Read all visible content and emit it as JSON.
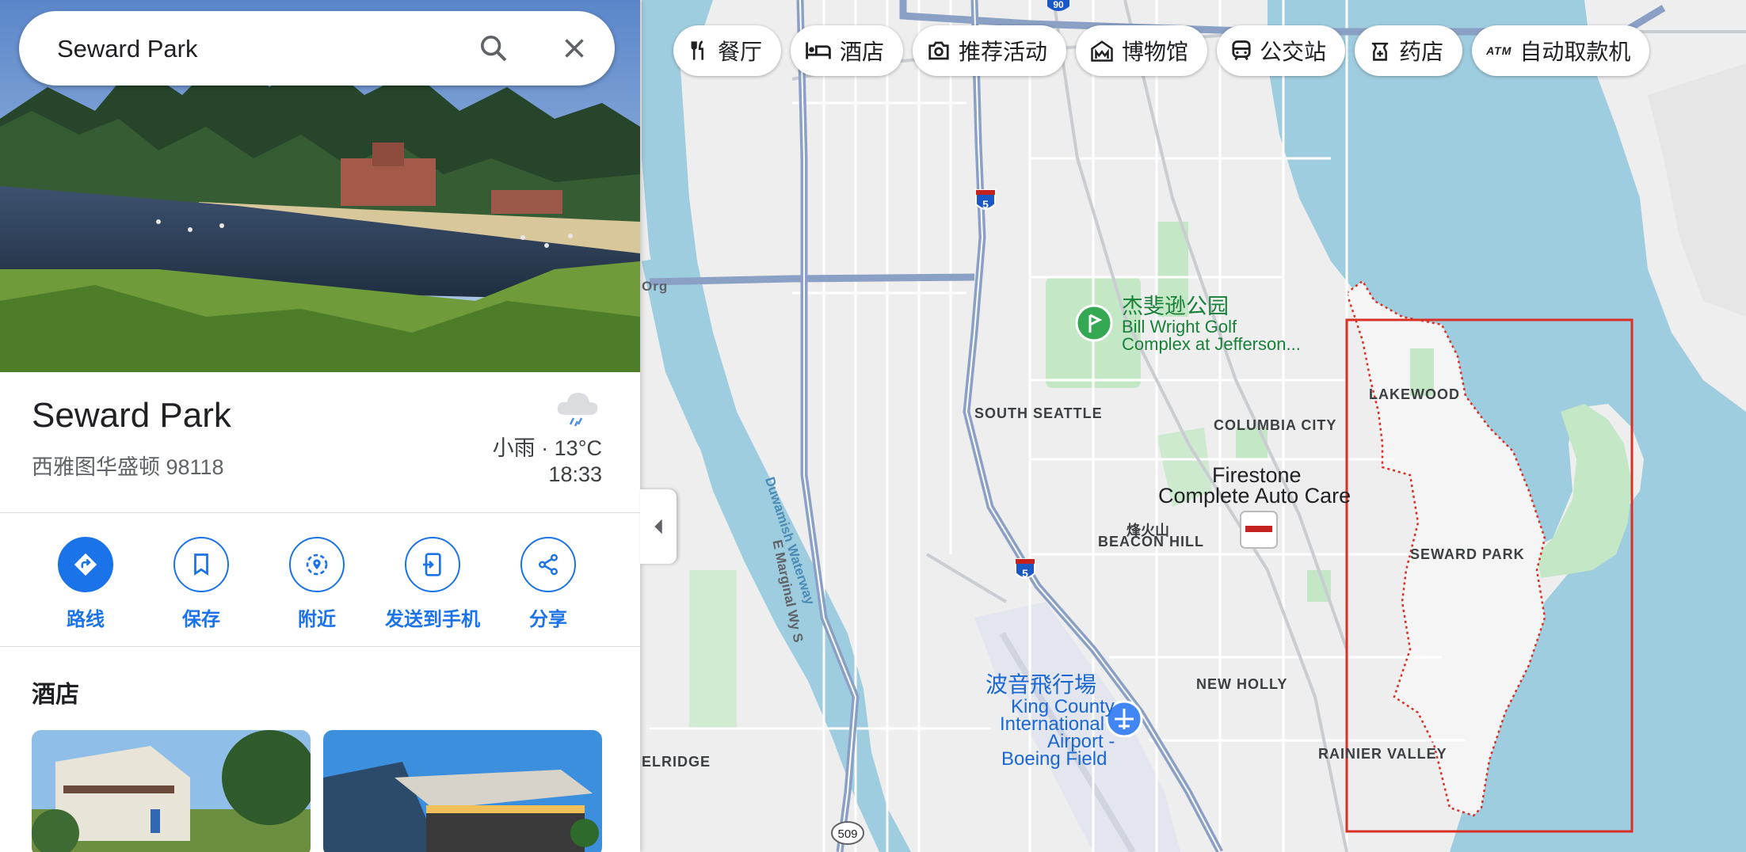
{
  "search": {
    "value": "Seward Park"
  },
  "place": {
    "title": "Seward Park",
    "address": "西雅图华盛顿 98118",
    "weather_condition": "小雨 · 13°C",
    "time": "18:33"
  },
  "actions": [
    {
      "label": "路线",
      "icon": "directions-icon"
    },
    {
      "label": "保存",
      "icon": "bookmark-icon"
    },
    {
      "label": "附近",
      "icon": "nearby-icon"
    },
    {
      "label": "发送到手机",
      "icon": "send-to-phone-icon"
    },
    {
      "label": "分享",
      "icon": "share-icon"
    }
  ],
  "hotels": {
    "section_title": "酒店"
  },
  "chips": [
    {
      "label": "餐厅",
      "icon": "restaurant-icon"
    },
    {
      "label": "酒店",
      "icon": "hotel-icon"
    },
    {
      "label": "推荐活动",
      "icon": "camera-icon"
    },
    {
      "label": "博物馆",
      "icon": "museum-icon"
    },
    {
      "label": "公交站",
      "icon": "transit-icon"
    },
    {
      "label": "药店",
      "icon": "pharmacy-icon"
    },
    {
      "label": "自动取款机",
      "icon": "atm-icon"
    }
  ],
  "map": {
    "labels": {
      "south_seattle": "SOUTH SEATTLE",
      "columbia_city": "COLUMBIA CITY",
      "lakewood": "LAKEWOOD",
      "seward_park": "SEWARD PARK",
      "beacon_hill_cn": "烽火山",
      "beacon_hill": "BEACON HILL",
      "new_holly": "NEW HOLLY",
      "rainier_valley": "RAINIER VALLEY",
      "elridge": "ELRIDGE",
      "org": "Org",
      "marginal_way": "E Marginal Wy S",
      "duwamish": "Duwamish Waterway"
    },
    "pois": {
      "jefferson_cn": "杰斐逊公园",
      "jefferson_line1": "Bill Wright Golf",
      "jefferson_line2": "Complex at Jefferson...",
      "firestone_line1": "Firestone",
      "firestone_line2": "Complete Auto Care",
      "airport_cn": "波音飛行場",
      "airport_line1": "King County",
      "airport_line2": "International",
      "airport_line3": "Airport -",
      "airport_line4": "Boeing Field"
    },
    "shields": {
      "i5": "5",
      "i90": "90",
      "sr509": "509"
    },
    "colors": {
      "water": "#9fcde0",
      "park": "#c4e8c6",
      "land": "#eeeeee",
      "highway": "#8aa0c4",
      "highlight": "#d93025"
    }
  }
}
